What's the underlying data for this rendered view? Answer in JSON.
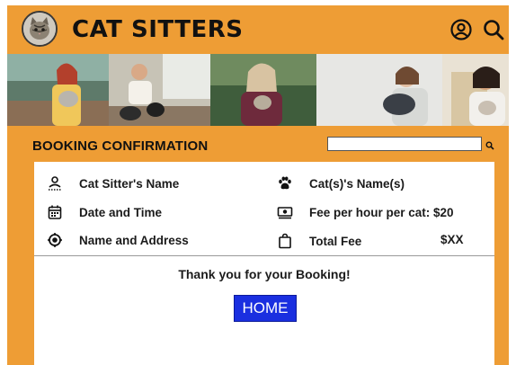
{
  "app": {
    "title": "CAT SITTERS"
  },
  "header": {
    "logo_icon": "cat-face-logo",
    "profile_icon": "user-circle-icon",
    "search_icon": "search-icon"
  },
  "banner": {
    "photos": [
      "woman-with-cat",
      "man-with-cats",
      "woman-holding-cat",
      "woman-with-cat-glasses",
      "smiling-woman-with-cat"
    ]
  },
  "booking": {
    "section_title": "BOOKING CONFIRMATION",
    "search": {
      "value": "",
      "placeholder": ""
    },
    "left_rows": [
      {
        "label": "Cat Sitter's Name",
        "icon": "person-icon"
      },
      {
        "label": "Date and Time",
        "icon": "calendar-icon"
      },
      {
        "label": "Name and Address",
        "icon": "location-icon"
      }
    ],
    "right_rows": [
      {
        "label": "Cat(s)'s Name(s)",
        "icon": "paw-icon"
      },
      {
        "label": "Fee per hour per cat: $20",
        "icon": "money-icon"
      },
      {
        "label": "Total Fee",
        "icon": "shopping-bag-icon",
        "value": "$XX"
      }
    ],
    "thanks_text": "Thank you for your Booking!",
    "home_button": "HOME"
  },
  "colors": {
    "background": "#ee9d35",
    "card": "#ffffff",
    "button": "#1a2fe0"
  }
}
